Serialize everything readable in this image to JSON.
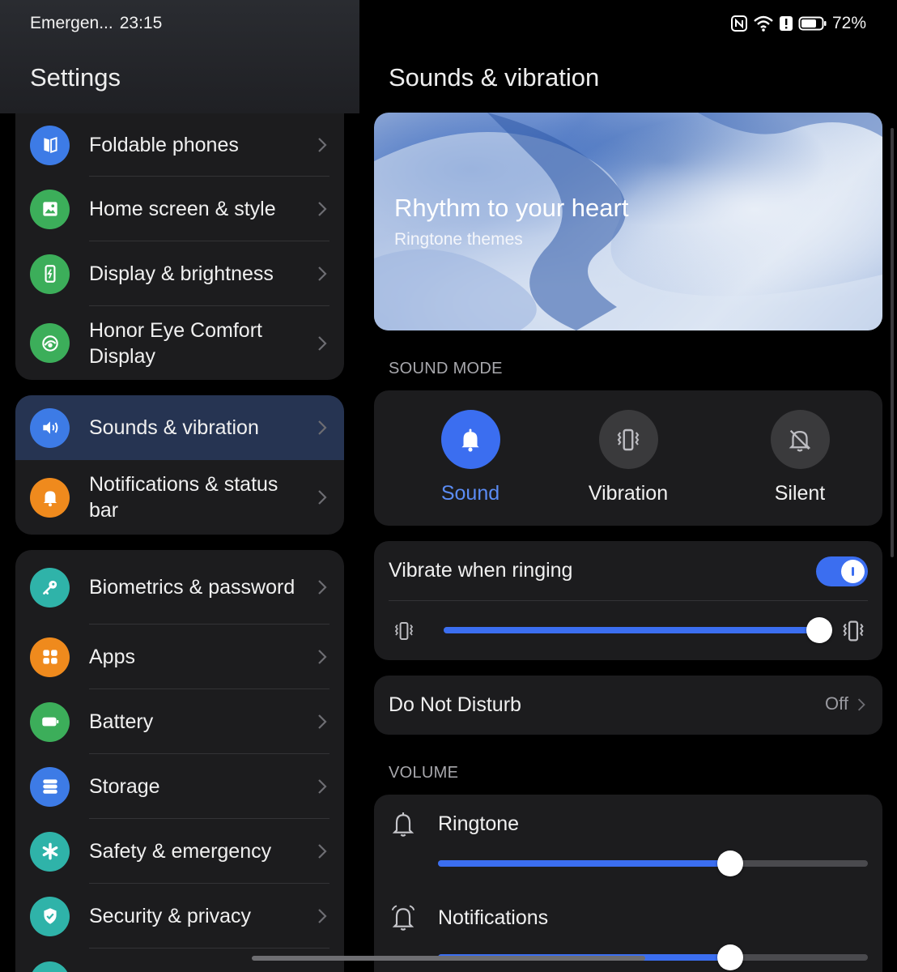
{
  "status_bar": {
    "carrier": "Emergen...",
    "time": "23:15",
    "battery": "72%"
  },
  "left": {
    "title": "Settings",
    "groups": [
      {
        "items": [
          {
            "label": "Foldable phones",
            "icon": "foldable-icon",
            "color": "#3d7be6"
          },
          {
            "label": "Home screen & style",
            "icon": "image-icon",
            "color": "#3cae5a"
          },
          {
            "label": "Display & brightness",
            "icon": "phone-brightness-icon",
            "color": "#3cae5a"
          },
          {
            "label": "Honor Eye Comfort Display",
            "icon": "eye-comfort-icon",
            "color": "#3cae5a"
          }
        ]
      },
      {
        "items": [
          {
            "label": "Sounds & vibration",
            "icon": "speaker-icon",
            "color": "#3d7be6",
            "active": true
          },
          {
            "label": "Notifications & status bar",
            "icon": "bell-icon",
            "color": "#ef8a1d"
          }
        ]
      },
      {
        "items": [
          {
            "label": "Biometrics & password",
            "icon": "key-icon",
            "color": "#2fb3a9"
          },
          {
            "label": "Apps",
            "icon": "apps-grid-icon",
            "color": "#ef8a1d"
          },
          {
            "label": "Battery",
            "icon": "battery-icon",
            "color": "#3cae5a"
          },
          {
            "label": "Storage",
            "icon": "storage-icon",
            "color": "#3d7be6"
          },
          {
            "label": "Safety & emergency",
            "icon": "asterisk-icon",
            "color": "#2fb3a9"
          },
          {
            "label": "Security & privacy",
            "icon": "shield-check-icon",
            "color": "#2fb3a9"
          }
        ]
      }
    ]
  },
  "right": {
    "title": "Sounds & vibration",
    "banner": {
      "title": "Rhythm to your heart",
      "subtitle": "Ringtone themes"
    },
    "sound_mode": {
      "section_label": "SOUND MODE",
      "modes": [
        {
          "label": "Sound",
          "icon": "bell-icon",
          "selected": true
        },
        {
          "label": "Vibration",
          "icon": "vibration-icon",
          "selected": false
        },
        {
          "label": "Silent",
          "icon": "bell-off-icon",
          "selected": false
        }
      ],
      "accent": "#3b6ef0"
    },
    "vibrate_when_ringing": {
      "label": "Vibrate when ringing",
      "enabled": true,
      "intensity": 1.0
    },
    "do_not_disturb": {
      "label": "Do Not Disturb",
      "value": "Off"
    },
    "volume": {
      "section_label": "VOLUME",
      "items": [
        {
          "label": "Ringtone",
          "icon": "bell-outline-icon",
          "level": 0.68
        },
        {
          "label": "Notifications",
          "icon": "alarm-bell-icon",
          "level": 0.68
        }
      ]
    }
  }
}
